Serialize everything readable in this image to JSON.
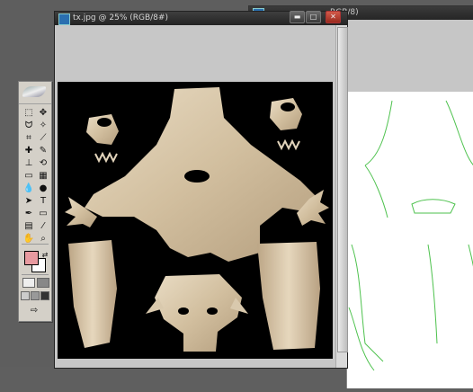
{
  "document": {
    "title": "tx.jpg @ 25% (RGB/8#)",
    "buttons": {
      "minimize": "▬",
      "maximize": "□",
      "close": "✕"
    }
  },
  "back_document": {
    "title": "RGB/8)"
  },
  "toolbox": {
    "foreground_color": "#e89aa0",
    "background_color": "#ffffff",
    "tools": [
      {
        "name": "marquee-tool-icon",
        "glyph": "⬚"
      },
      {
        "name": "move-tool-icon",
        "glyph": "✥"
      },
      {
        "name": "lasso-tool-icon",
        "glyph": "ᗢ"
      },
      {
        "name": "magic-wand-tool-icon",
        "glyph": "✧"
      },
      {
        "name": "crop-tool-icon",
        "glyph": "⌗"
      },
      {
        "name": "slice-tool-icon",
        "glyph": "⟋"
      },
      {
        "name": "healing-tool-icon",
        "glyph": "✚"
      },
      {
        "name": "brush-tool-icon",
        "glyph": "✎"
      },
      {
        "name": "stamp-tool-icon",
        "glyph": "⊥"
      },
      {
        "name": "history-brush-icon",
        "glyph": "⟲"
      },
      {
        "name": "eraser-tool-icon",
        "glyph": "▭"
      },
      {
        "name": "gradient-tool-icon",
        "glyph": "▦"
      },
      {
        "name": "blur-tool-icon",
        "glyph": "💧"
      },
      {
        "name": "dodge-tool-icon",
        "glyph": "●"
      },
      {
        "name": "path-select-icon",
        "glyph": "➤"
      },
      {
        "name": "type-tool-icon",
        "glyph": "T"
      },
      {
        "name": "pen-tool-icon",
        "glyph": "✒"
      },
      {
        "name": "shape-tool-icon",
        "glyph": "▭"
      },
      {
        "name": "notes-tool-icon",
        "glyph": "▤"
      },
      {
        "name": "eyedropper-tool-icon",
        "glyph": "⁄"
      },
      {
        "name": "hand-tool-icon",
        "glyph": "✋"
      },
      {
        "name": "zoom-tool-icon",
        "glyph": "⌕"
      }
    ]
  }
}
